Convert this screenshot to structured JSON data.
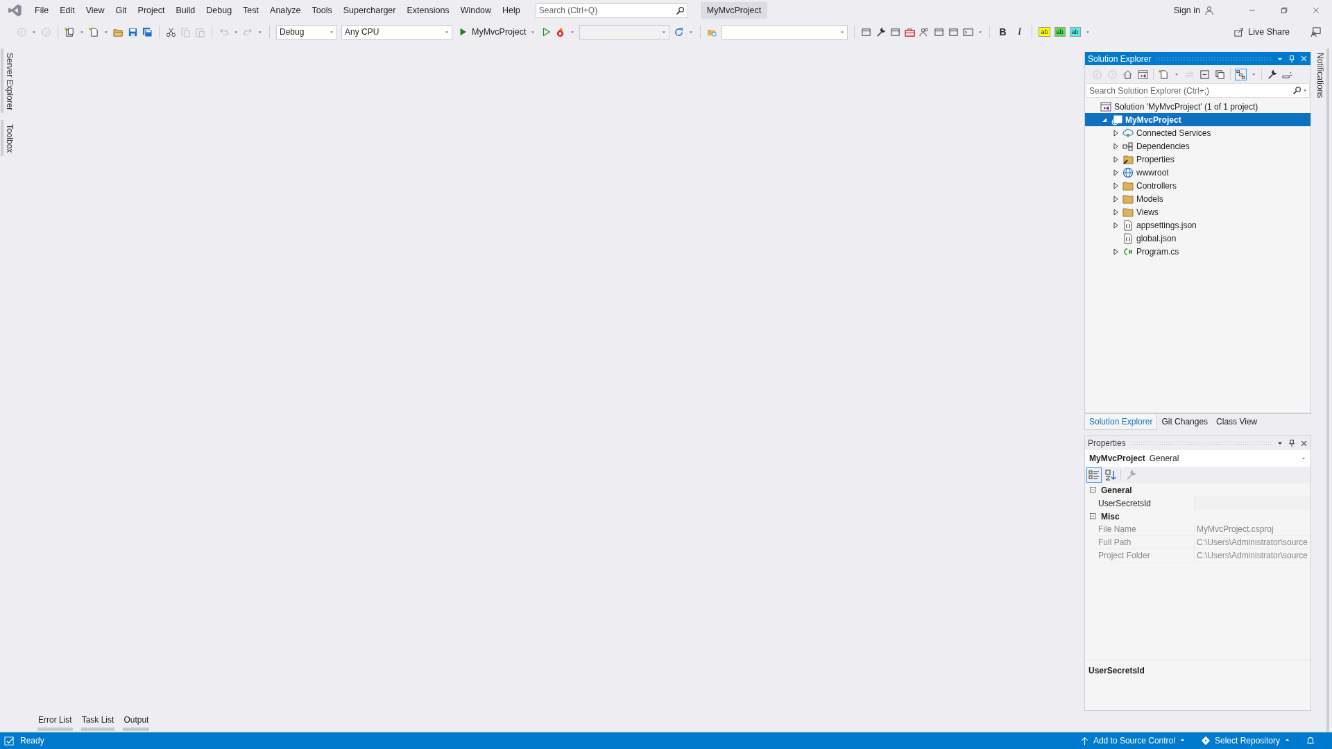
{
  "menu_bar": {
    "items": [
      "File",
      "Edit",
      "View",
      "Git",
      "Project",
      "Build",
      "Debug",
      "Test",
      "Analyze",
      "Tools",
      "Supercharger",
      "Extensions",
      "Window",
      "Help"
    ],
    "search": {
      "placeholder": "Search (Ctrl+Q)"
    },
    "solution_name": "MyMvcProject",
    "sign_in": "Sign in"
  },
  "toolbar": {
    "configuration": "Debug",
    "platform": "Any CPU",
    "start_target": "MyMvcProject",
    "text_buttons": [
      "B",
      "I"
    ],
    "highlight_buttons": [
      {
        "label": "ab",
        "color": "#ffff00"
      },
      {
        "label": "ab",
        "color": "#55dd55"
      },
      {
        "label": "ab",
        "color": "#55eeee"
      }
    ],
    "live_share": "Live Share"
  },
  "left_tabs": [
    "Server Explorer",
    "Toolbox"
  ],
  "right_tabs": [
    "Notifications"
  ],
  "solution_explorer": {
    "title": "Solution Explorer",
    "search": {
      "placeholder": "Search Solution Explorer (Ctrl+;)"
    },
    "tree": [
      {
        "label": "Solution 'MyMvcProject' (1 of 1 project)",
        "kind": "solution",
        "selected": false,
        "children": [
          {
            "label": "MyMvcProject",
            "kind": "project",
            "expanded": true,
            "selected": true,
            "children": [
              {
                "label": "Connected Services",
                "kind": "services",
                "expanded": false,
                "selected": false
              },
              {
                "label": "Dependencies",
                "kind": "dependencies",
                "expanded": false,
                "selected": false
              },
              {
                "label": "Properties",
                "kind": "properties",
                "expanded": false,
                "selected": false
              },
              {
                "label": "wwwroot",
                "kind": "web",
                "expanded": false,
                "selected": false
              },
              {
                "label": "Controllers",
                "kind": "folder",
                "expanded": false,
                "selected": false
              },
              {
                "label": "Models",
                "kind": "folder",
                "expanded": false,
                "selected": false
              },
              {
                "label": "Views",
                "kind": "folder",
                "expanded": false,
                "selected": false
              },
              {
                "label": "appsettings.json",
                "kind": "json",
                "expanded": false,
                "selected": false
              },
              {
                "label": "global.json",
                "kind": "json",
                "selected": false
              },
              {
                "label": "Program.cs",
                "kind": "csharp",
                "expanded": false,
                "selected": false
              }
            ]
          }
        ]
      }
    ]
  },
  "panel_tabs": [
    {
      "label": "Solution Explorer",
      "selected": true
    },
    {
      "label": "Git Changes",
      "selected": false
    },
    {
      "label": "Class View",
      "selected": false
    }
  ],
  "properties": {
    "title": "Properties",
    "object": "MyMvcProject",
    "object_type": "General",
    "categories": [
      {
        "name": "General",
        "expanded": true,
        "rows": [
          {
            "name": "UserSecretsId",
            "disabled": false
          }
        ]
      },
      {
        "name": "Misc",
        "expanded": true,
        "rows": [
          {
            "name": "File Name",
            "value": "MyMvcProject.csproj",
            "disabled": true
          },
          {
            "name": "Full Path",
            "value": "C:\\Users\\Administrator\\source",
            "disabled": true
          },
          {
            "name": "Project Folder",
            "value": "C:\\Users\\Administrator\\source",
            "disabled": true
          }
        ]
      }
    ],
    "description_title": "UserSecretsId"
  },
  "bottom_tabs": [
    "Error List",
    "Task List",
    "Output"
  ],
  "status_bar": {
    "text": "Ready",
    "source_control": "Add to Source Control",
    "repository": "Select Repository"
  }
}
